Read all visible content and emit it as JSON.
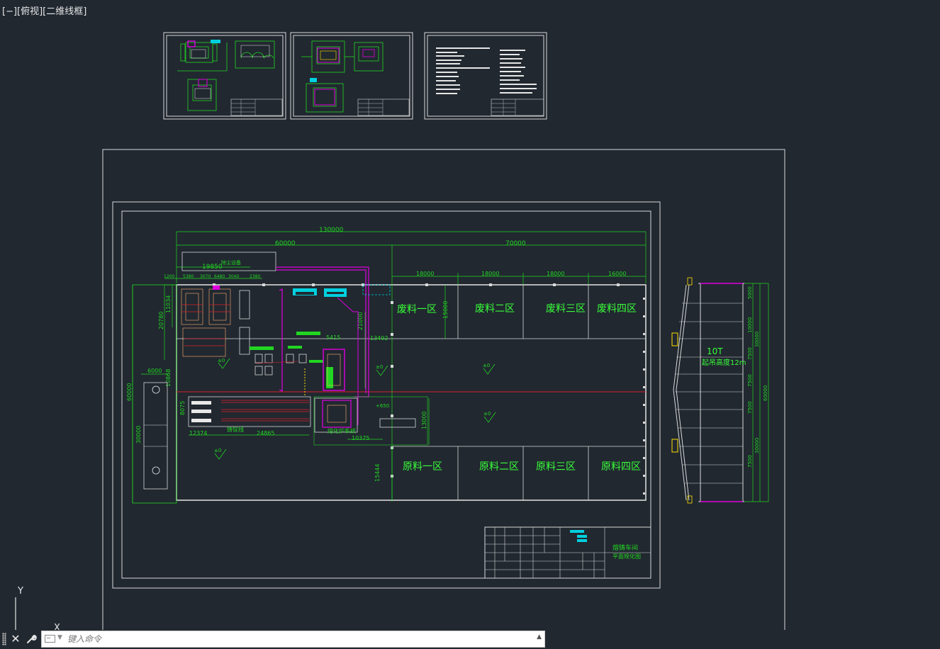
{
  "viewport": {
    "view_label": "[−][俯视][二维线框]"
  },
  "ucs": {
    "y_label": "Y",
    "x_label": "X"
  },
  "sheets": {
    "plan_title_line1": "熔铸车间",
    "plan_title_line2": "平面规化图"
  },
  "plan": {
    "dims_top": {
      "total": "130000",
      "left": "60000",
      "right": "70000",
      "left_small": "19850",
      "bays": [
        "18000",
        "18000",
        "18000",
        "16000"
      ]
    },
    "dims_small": [
      "1200",
      "5380",
      "3070",
      "6480",
      "3040",
      "2380"
    ],
    "dims_left": [
      "20780",
      "11034",
      "10868",
      "60000",
      "6000",
      "8075",
      "30000"
    ],
    "dims_mid": [
      "21000",
      "5415",
      "13492",
      "13000",
      "10375",
      "12374",
      "24865",
      "15000",
      "15444"
    ],
    "zones_top": [
      "废料一区",
      "废料二区",
      "废料三区",
      "废料四区"
    ],
    "zones_bottom": [
      "原料一区",
      "原料二区",
      "原料三区",
      "原料四区"
    ],
    "labels": {
      "dust_equipment": "除尘设备",
      "casting_line": "铸锭线",
      "level": "±0",
      "level2": "+650",
      "melting": "熔化炉系统"
    }
  },
  "section": {
    "crane": "10T",
    "lift_height": "起吊高度12m",
    "dims_right": [
      "5000",
      "10000",
      "7500",
      "7500",
      "7500",
      "7500",
      "30000",
      "30000",
      "60000"
    ]
  },
  "command_line": {
    "close_symbol": "✕",
    "tool_symbol": "🔧",
    "placeholder": "键入命令",
    "history_arrow": "▲"
  },
  "colors": {
    "background": "#212830",
    "frame": "#d9d9d9",
    "dim_green": "#22d622",
    "zone_green": "#39ff39",
    "magenta": "#e000e0",
    "red_axis": "#d8202a",
    "cyan": "#00d0e0",
    "yellow": "#ffe000"
  }
}
